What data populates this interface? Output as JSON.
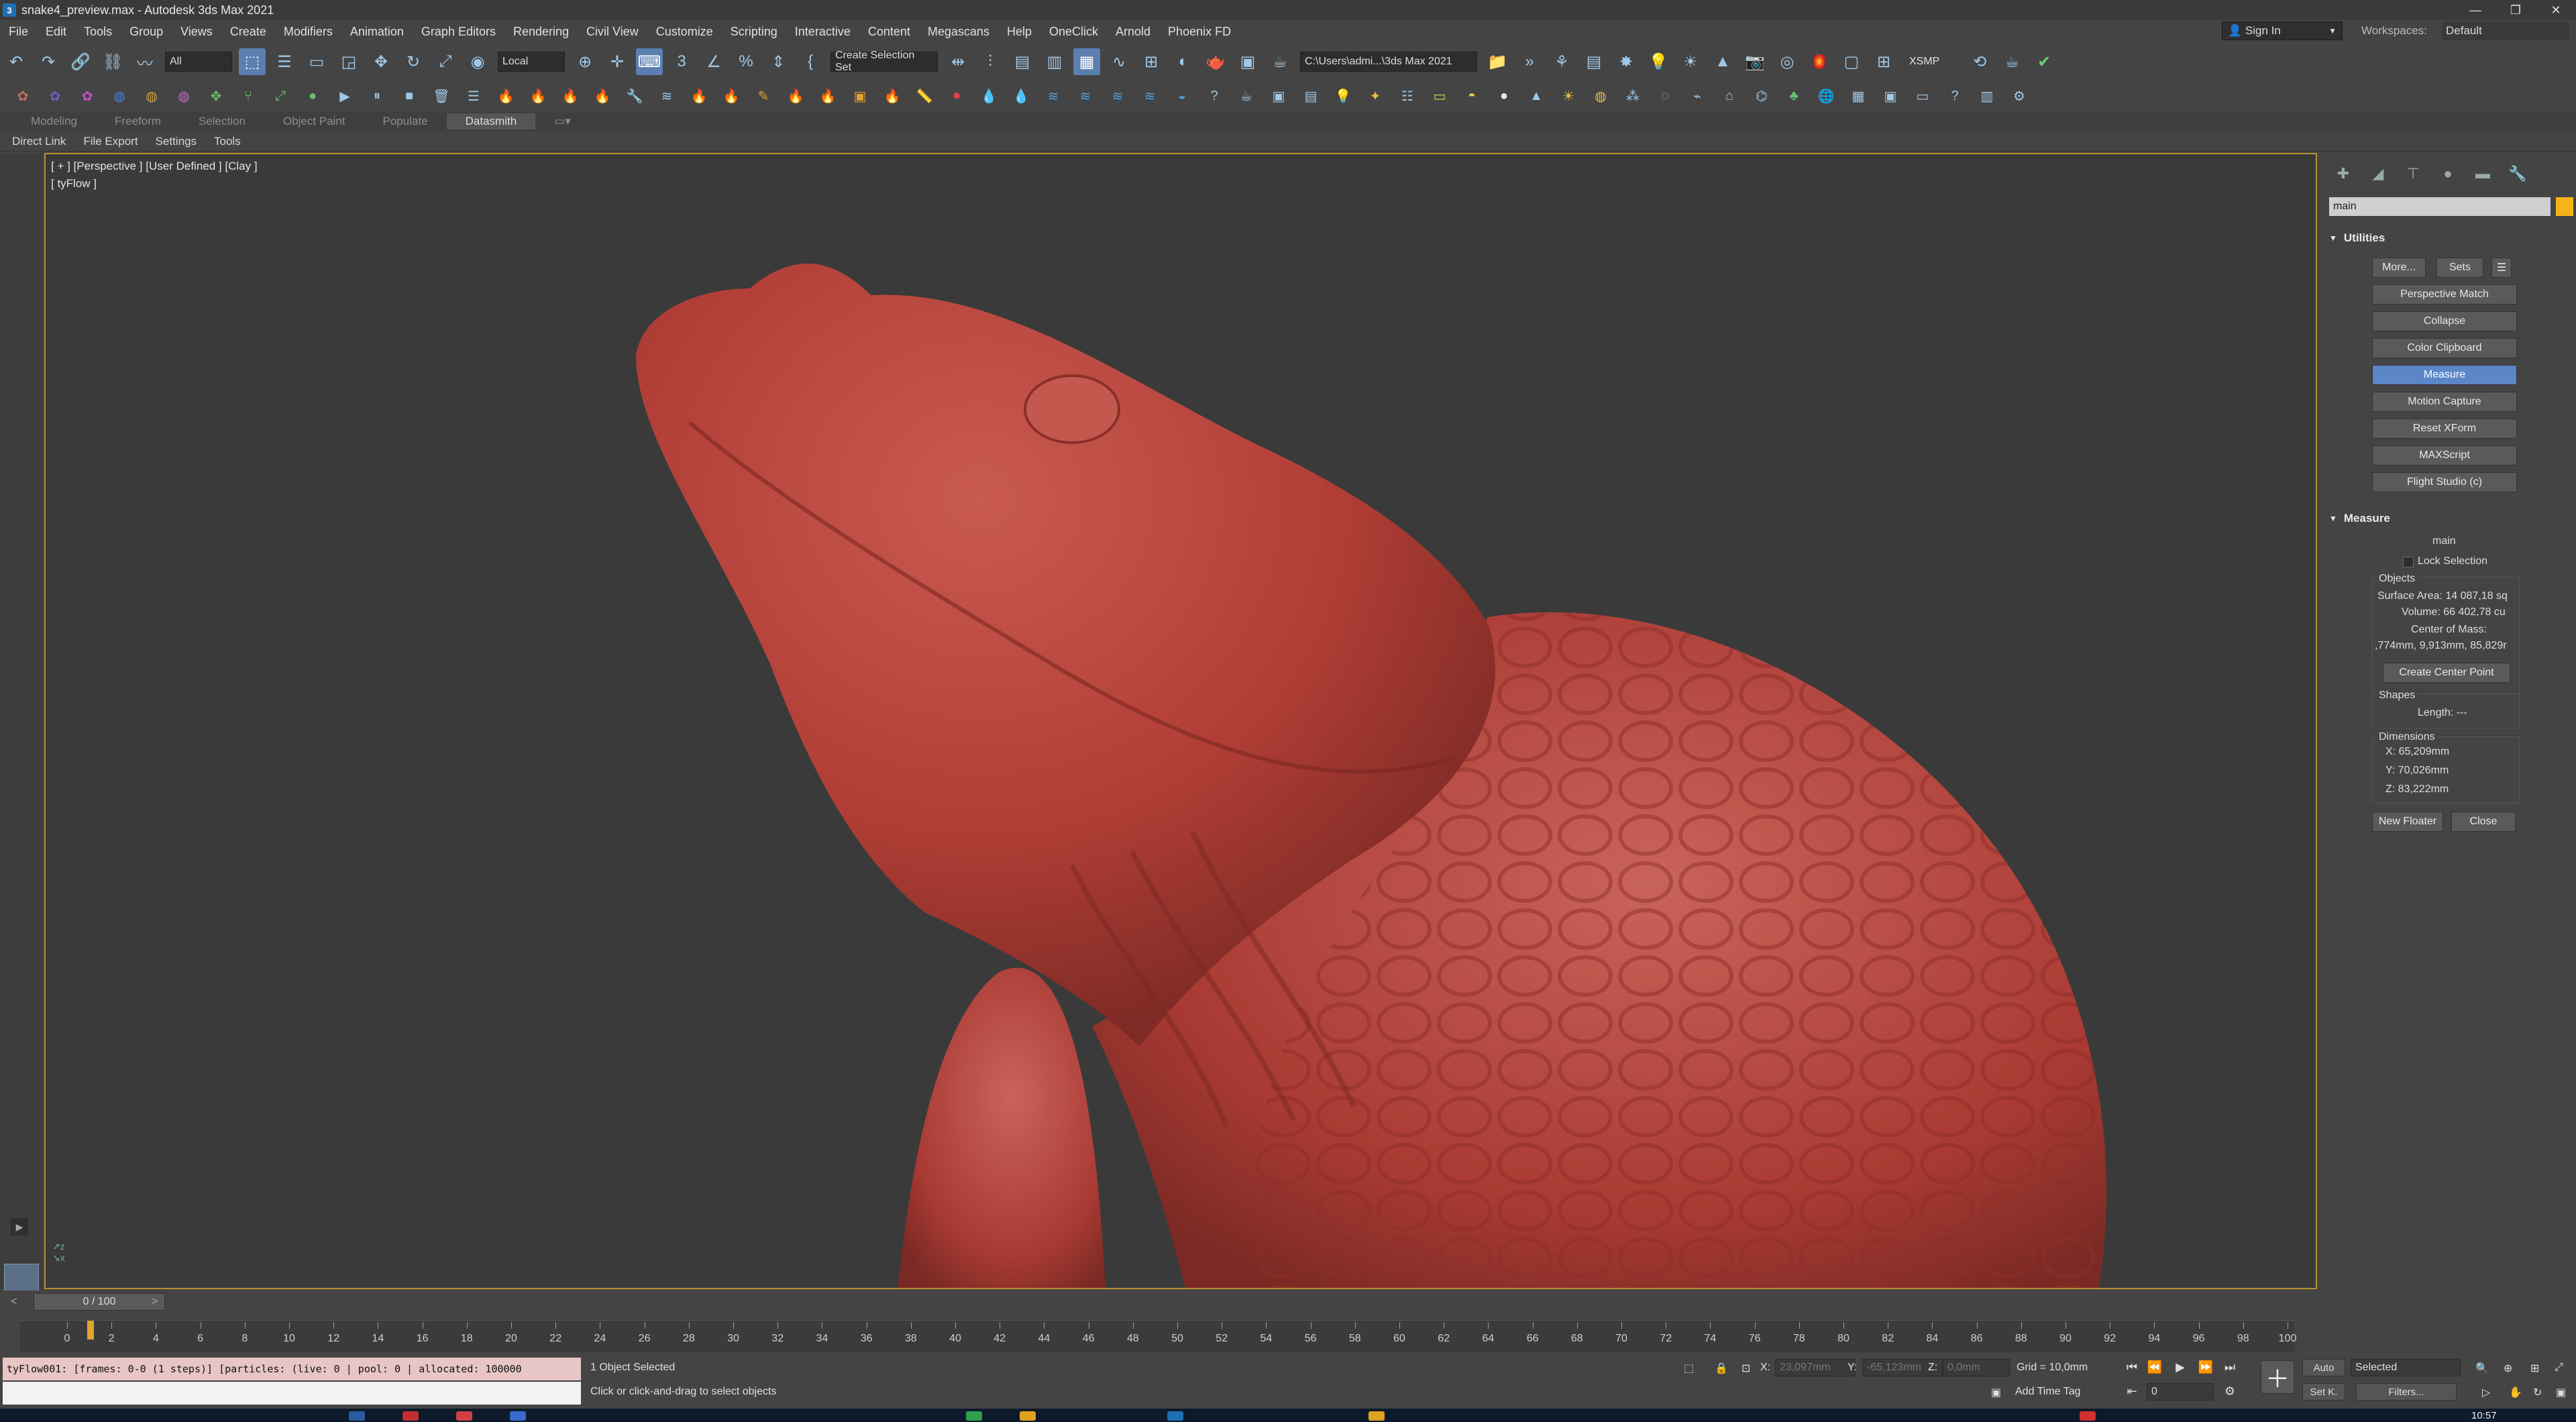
{
  "window": {
    "title": "snake4_preview.max - Autodesk 3ds Max 2021",
    "controls": {
      "minimize": "—",
      "maximize": "❐",
      "close": "✕"
    }
  },
  "menu": {
    "items": [
      "File",
      "Edit",
      "Tools",
      "Group",
      "Views",
      "Create",
      "Modifiers",
      "Animation",
      "Graph Editors",
      "Rendering",
      "Civil View",
      "Customize",
      "Scripting",
      "Interactive",
      "Content",
      "Megascans",
      "Help",
      "OneClick",
      "Arnold",
      "Phoenix FD"
    ],
    "sign_in": "Sign In",
    "workspaces_label": "Workspaces:",
    "workspace_value": "Default"
  },
  "toolbar": {
    "selection_filter": "All",
    "reference_coord": "Local",
    "selection_set": "Create Selection Set",
    "project_path": "C:\\Users\\admi...\\3ds Max 2021",
    "xsmp": "XSMP"
  },
  "ribbon": {
    "tabs": [
      "Modeling",
      "Freeform",
      "Selection",
      "Object Paint",
      "Populate",
      "Datasmith"
    ],
    "active": "Datasmith",
    "subtabs": [
      "Direct Link",
      "File Export",
      "Settings",
      "Tools"
    ]
  },
  "viewport": {
    "label": "[ + ] [Perspective ] [User Defined ] [Clay ]",
    "sublabel": "[ tyFlow ]",
    "model_color": "#b9433b"
  },
  "command_panel": {
    "object_name": "main",
    "utilities_title": "Utilities",
    "more_button": "More...",
    "sets_button": "Sets",
    "utilities": [
      "Perspective Match",
      "Collapse",
      "Color Clipboard",
      "Measure",
      "Motion Capture",
      "Reset XForm",
      "MAXScript",
      "Flight Studio (c)"
    ],
    "active_utility": "Measure",
    "measure_title": "Measure",
    "measure_object": "main",
    "lock_selection": "Lock Selection",
    "objects_label": "Objects",
    "surface_area": "Surface Area: 14 087,18 sq",
    "volume": "Volume: 66 402,78 cu",
    "center_of_mass_label": "Center of Mass:",
    "center_of_mass_value": ",774mm, 9,913mm, 85,829r",
    "create_center_point": "Create Center Point",
    "shapes_label": "Shapes",
    "length": "Length: ---",
    "dimensions_label": "Dimensions",
    "dim_x": "X:  65,209mm",
    "dim_y": "Y:  70,026mm",
    "dim_z": "Z:  83,222mm",
    "new_floater": "New Floater",
    "close": "Close"
  },
  "timeline": {
    "frame_display": "0 / 100",
    "prev": "<",
    "next": ">",
    "ticks": [
      "0",
      "2",
      "4",
      "6",
      "8",
      "10",
      "12",
      "14",
      "16",
      "18",
      "20",
      "22",
      "24",
      "26",
      "28",
      "30",
      "32",
      "34",
      "36",
      "38",
      "40",
      "42",
      "44",
      "46",
      "48",
      "50",
      "52",
      "54",
      "56",
      "58",
      "60",
      "62",
      "64",
      "66",
      "68",
      "70",
      "72",
      "74",
      "76",
      "78",
      "80",
      "82",
      "84",
      "86",
      "88",
      "90",
      "92",
      "94",
      "96",
      "98",
      "100"
    ]
  },
  "status": {
    "maxscript_output": "tyFlow001: [frames: 0-0 (1 steps)] [particles: (live: 0 | pool: 0 | allocated: 100000",
    "selection_info": "1 Object Selected",
    "prompt": "Click or click-and-drag to select objects",
    "x_label": "X:",
    "x_value": "23,097mm",
    "y_label": "Y:",
    "y_value": "-65,123mm",
    "z_label": "Z:",
    "z_value": "0,0mm",
    "grid": "Grid = 10,0mm",
    "add_time_tag": "Add Time Tag",
    "auto": "Auto",
    "set_key": "Set K.",
    "key_filter": "Selected",
    "filters": "Filters...",
    "current_frame": "0"
  },
  "taskbar": {
    "clock": "10:57"
  }
}
